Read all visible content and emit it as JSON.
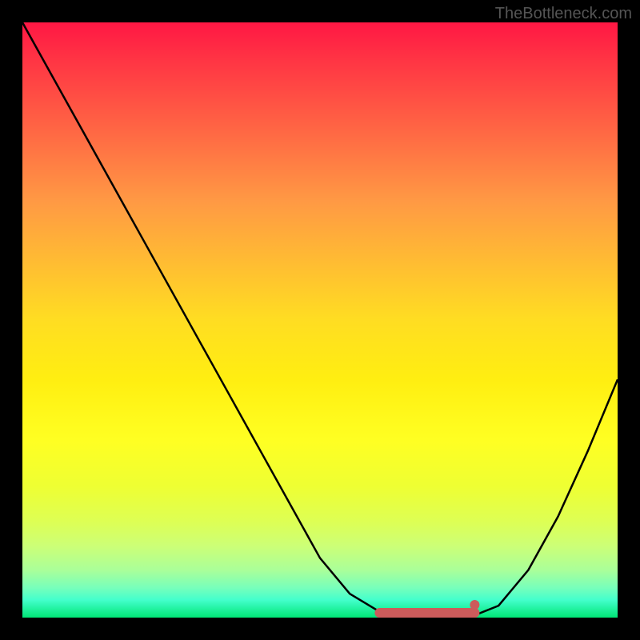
{
  "watermark": "TheBottleneck.com",
  "chart_data": {
    "type": "line",
    "title": "",
    "xlabel": "",
    "ylabel": "",
    "x": [
      0.0,
      0.05,
      0.1,
      0.15,
      0.2,
      0.25,
      0.3,
      0.35,
      0.4,
      0.45,
      0.5,
      0.55,
      0.6,
      0.65,
      0.7,
      0.75,
      0.8,
      0.85,
      0.9,
      0.95,
      1.0
    ],
    "y": [
      1.0,
      0.91,
      0.82,
      0.73,
      0.64,
      0.55,
      0.46,
      0.37,
      0.28,
      0.19,
      0.1,
      0.04,
      0.01,
      0.0,
      0.0,
      0.0,
      0.02,
      0.08,
      0.17,
      0.28,
      0.4
    ],
    "xlim": [
      0,
      1
    ],
    "ylim": [
      0,
      1
    ],
    "minimum_marker": {
      "x_start": 0.6,
      "x_end": 0.76,
      "color": "#d16060"
    },
    "gradient_bg": true
  }
}
